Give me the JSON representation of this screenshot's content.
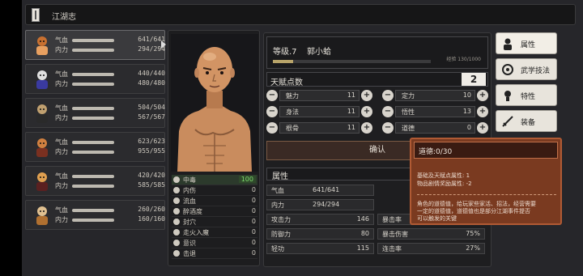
{
  "window": {
    "title": "江湖志"
  },
  "party": [
    {
      "hp_label": "气血",
      "mp_label": "内力",
      "hp": "641/641",
      "mp": "294/294",
      "hp_ratio": 1.0,
      "mp_ratio": 1.0,
      "selected": true
    },
    {
      "hp_label": "气血",
      "mp_label": "内力",
      "hp": "440/440",
      "mp": "480/480",
      "hp_ratio": 1.0,
      "mp_ratio": 1.0
    },
    {
      "hp_label": "气血",
      "mp_label": "内力",
      "hp": "504/504",
      "mp": "567/567",
      "hp_ratio": 1.0,
      "mp_ratio": 1.0
    },
    {
      "hp_label": "气血",
      "mp_label": "内力",
      "hp": "623/623",
      "mp": "955/955",
      "hp_ratio": 1.0,
      "mp_ratio": 1.0
    },
    {
      "hp_label": "气血",
      "mp_label": "内力",
      "hp": "420/420",
      "mp": "585/585",
      "hp_ratio": 1.0,
      "mp_ratio": 1.0
    },
    {
      "hp_label": "气血",
      "mp_label": "内力",
      "hp": "260/260",
      "mp": "160/160",
      "hp_ratio": 1.0,
      "mp_ratio": 1.0
    }
  ],
  "status": [
    {
      "name": "中毒",
      "value": "100"
    },
    {
      "name": "内伤",
      "value": "0"
    },
    {
      "name": "流血",
      "value": "0"
    },
    {
      "name": "醉酒度",
      "value": "0"
    },
    {
      "name": "封穴",
      "value": "0"
    },
    {
      "name": "走火入魔",
      "value": "0"
    },
    {
      "name": "意识",
      "value": "0"
    },
    {
      "name": "击退",
      "value": "0"
    }
  ],
  "character": {
    "level": "等级.7",
    "name": "郭小蛤",
    "exp": "经验 130/1000",
    "exp_ratio": 0.13,
    "talent_label": "天赋点数",
    "talent_points": "2"
  },
  "attributes": [
    {
      "name": "魅力",
      "value": "11"
    },
    {
      "name": "定力",
      "value": "10"
    },
    {
      "name": "身法",
      "value": "11"
    },
    {
      "name": "悟性",
      "value": "13"
    },
    {
      "name": "根骨",
      "value": "11"
    },
    {
      "name": "道德",
      "value": "0"
    }
  ],
  "confirm_label": "确认",
  "props": {
    "title": "属性",
    "hp_label": "气血",
    "hp_value": "641/641",
    "mp_label": "内力",
    "mp_value": "294/294",
    "rows": [
      {
        "k": "攻击力",
        "v": "146"
      },
      {
        "k": "暴击率",
        "v": ""
      },
      {
        "k": "防御力",
        "v": "80"
      },
      {
        "k": "暴击伤害",
        "v": "75%"
      },
      {
        "k": "轻功",
        "v": "115"
      },
      {
        "k": "连击率",
        "v": "27%"
      }
    ]
  },
  "tooltip": {
    "title": "道德:0/30",
    "line1": "基础及天赋点属性: 1",
    "line2": "物品剧情奖励属性: -2",
    "line3": "角色的道德值，给玩家些家活、招法，经营需要",
    "line4": "一定的道德值，道德值也是部分江湖事件提否",
    "line5": "可以触发的关键"
  },
  "menu": [
    {
      "label": "属性",
      "icon": "person-icon"
    },
    {
      "label": "武学技法",
      "icon": "martial-arts-icon"
    },
    {
      "label": "特性",
      "icon": "trait-icon"
    },
    {
      "label": "装备",
      "icon": "sword-icon"
    }
  ]
}
